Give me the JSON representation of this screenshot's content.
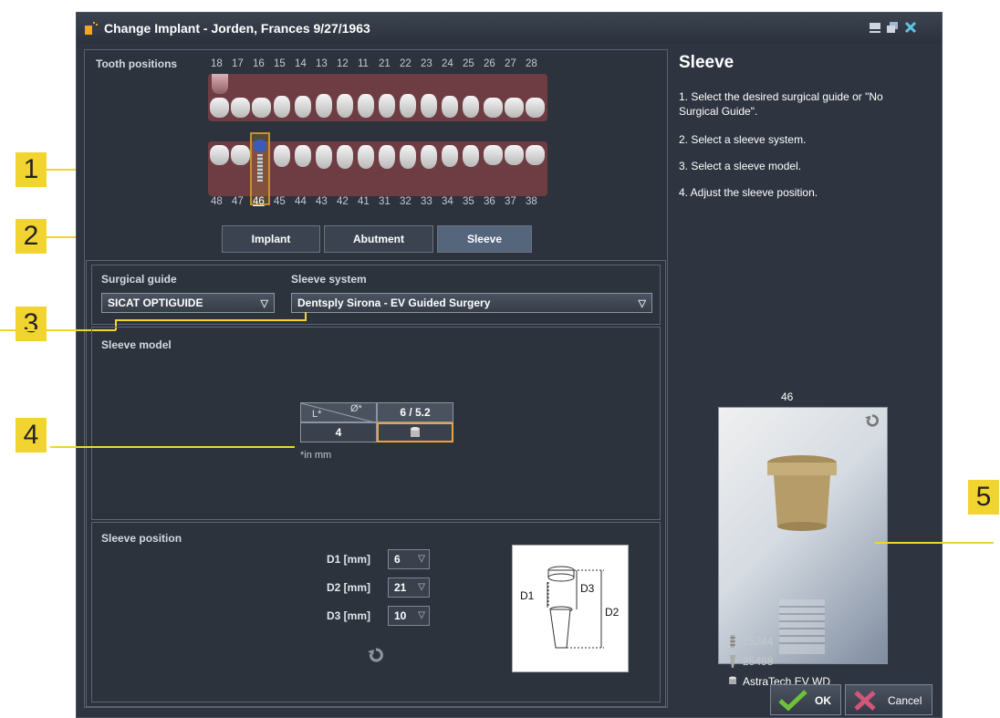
{
  "window": {
    "title": "Change Implant - Jorden, Frances 9/27/1963"
  },
  "tooth_positions": {
    "label": "Tooth positions",
    "upper": [
      "18",
      "17",
      "16",
      "15",
      "14",
      "13",
      "12",
      "11",
      "21",
      "22",
      "23",
      "24",
      "25",
      "26",
      "27",
      "28"
    ],
    "lower": [
      "48",
      "47",
      "46",
      "45",
      "44",
      "43",
      "42",
      "41",
      "31",
      "32",
      "33",
      "34",
      "35",
      "36",
      "37",
      "38"
    ],
    "selected": "46"
  },
  "steps": [
    "Implant",
    "Abutment",
    "Sleeve"
  ],
  "active_step": "Sleeve",
  "surgical_guide": {
    "label": "Surgical guide",
    "value": "SICAT OPTIGUIDE"
  },
  "sleeve_system": {
    "label": "Sleeve system",
    "value": "Dentsply Sirona - EV Guided Surgery"
  },
  "sleeve_model": {
    "label": "Sleeve model",
    "col_header_l": "L*",
    "col_header_d": "Ø*",
    "diameter": "6 / 5.2",
    "length": "4",
    "unit_note": "*in mm"
  },
  "sleeve_position": {
    "label": "Sleeve position",
    "d1_label": "D1 [mm]",
    "d1": "6",
    "d2_label": "D2 [mm]",
    "d2": "21",
    "d3_label": "D3 [mm]",
    "d3": "10",
    "diagram": {
      "d1": "D1",
      "d2": "D2",
      "d3": "D3"
    }
  },
  "instructions": {
    "title": "Sleeve",
    "step1": "1. Select the desired surgical guide or \"No Surgical Guide\".",
    "step2": "2. Select a sleeve system.",
    "step3": "3. Select a sleeve model.",
    "step4": "4. Adjust the sleeve position."
  },
  "preview": {
    "tooth": "46",
    "implant_id": "25244",
    "abutment_id": "25498",
    "sleeve_name": "AstraTech EV WD"
  },
  "buttons": {
    "ok": "OK",
    "cancel": "Cancel"
  },
  "callouts": [
    "1",
    "2",
    "3",
    "4",
    "5"
  ],
  "colors": {
    "accent": "#f2d431",
    "window_bg": "#2f3540",
    "selection": "#c8912b"
  }
}
